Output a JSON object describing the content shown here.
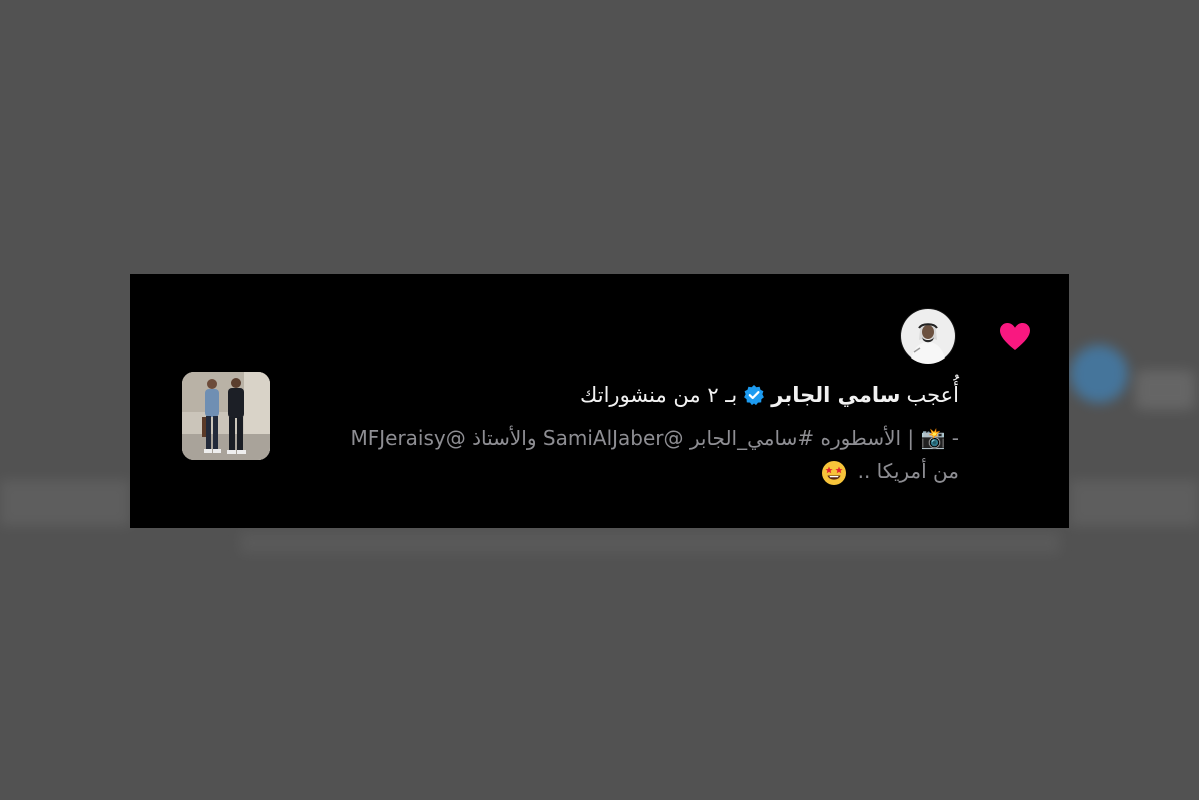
{
  "notification": {
    "action_prefix": "أُعجب",
    "liker_name": "سامي الجابر",
    "action_suffix": "بـ ٢ من منشوراتك",
    "post_line_1": "- 📸 | الأسطوره #سامي_الجابر @SamiAlJaber والأستاذ @MFJeraisy",
    "post_line_2": "من أمريكا .."
  },
  "icons": {
    "like": "heart-icon",
    "verified": "verified-badge-icon",
    "camera": "camera-flash-emoji",
    "star_struck": "star-struck-emoji"
  },
  "colors": {
    "heart": "#f91880",
    "verified": "#1d9bf0",
    "background": "#525252",
    "card": "#000000",
    "text_primary": "#f2f2f2",
    "text_secondary": "#8e8e93"
  }
}
